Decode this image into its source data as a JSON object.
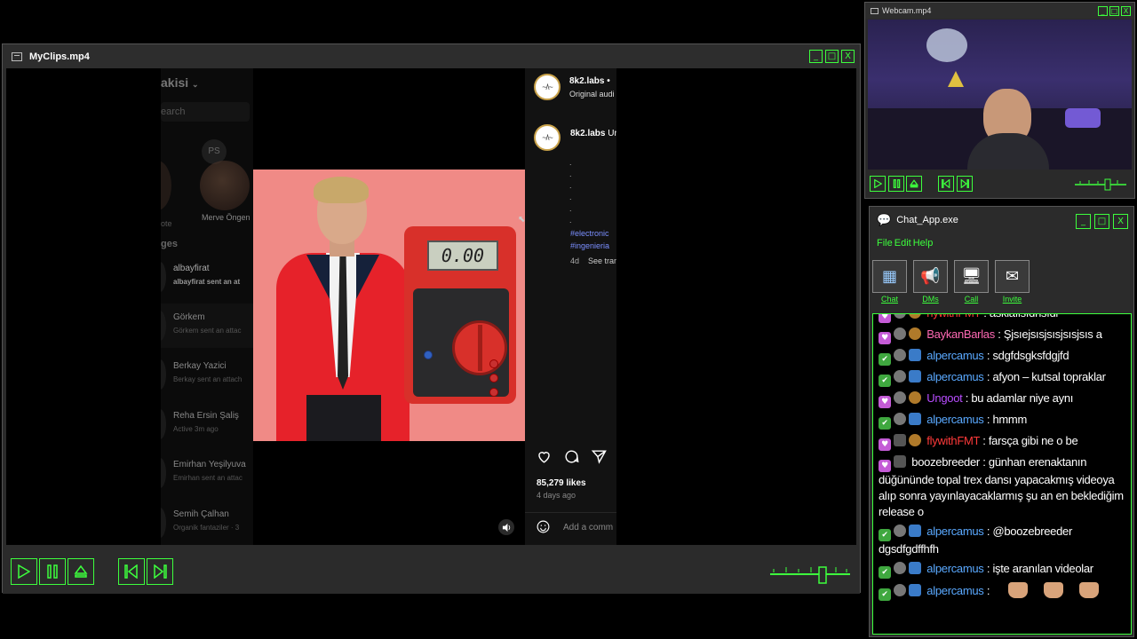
{
  "player": {
    "title": "MyClips.mp4",
    "window_buttons": [
      "_",
      "□",
      "X"
    ],
    "instagram": {
      "sidebar": {
        "account_partial": "akisi",
        "search_placeholder": "earch",
        "note_initials": "PS",
        "left_partial_label": "ote",
        "note_name": "Merve Öngen",
        "messages_heading_partial": "ges",
        "conversations": [
          {
            "name": "albayfirat",
            "sub": "albayfirat sent an at",
            "bold": true
          },
          {
            "name": "Görkem",
            "sub": "Görkem sent an attac",
            "bold": false
          },
          {
            "name": "Berkay Yazici",
            "sub": "Berkay sent an attach",
            "bold": false
          },
          {
            "name": "Reha Ersin Şaliş",
            "sub": "Active 3m ago",
            "bold": false
          },
          {
            "name": "Emirhan Yeşilyuva",
            "sub": "Emirhan sent an attac",
            "bold": false
          },
          {
            "name": "Semih Çalhan",
            "sub": "Organik fantaziler · 3",
            "bold": false
          }
        ]
      },
      "reel": {
        "lcd_reading": "0.00"
      },
      "post": {
        "author": "8k2.labs",
        "author_dot": "•",
        "audio": "Original audi",
        "caption_author": "8k2.labs",
        "caption_partial": "Ur",
        "dots": [
          ".",
          ".",
          ".",
          ".",
          ".",
          "."
        ],
        "hashtags": [
          "#electronic",
          "#ingenieria"
        ],
        "age_short": "4d",
        "see_translation": "See tran",
        "likes": "85,279 likes",
        "posted": "4 days ago",
        "add_comment": "Add a comm"
      }
    }
  },
  "webcam": {
    "title": "Webcam.mp4",
    "window_buttons": [
      "_",
      "□",
      "X"
    ]
  },
  "chat": {
    "title": "Chat_App.exe",
    "window_buttons": [
      "_",
      "□",
      "X"
    ],
    "menu": [
      "File",
      "Edit",
      "Help"
    ],
    "tools": [
      {
        "label": "Chat",
        "icon": "chat-window-icon",
        "glyph": "▦"
      },
      {
        "label": "DMs",
        "icon": "megaphone-icon",
        "glyph": "📢"
      },
      {
        "label": "Call",
        "icon": "monitor-icon",
        "glyph": "🖥"
      },
      {
        "label": "Invite",
        "icon": "envelope-icon",
        "glyph": "✉"
      }
    ],
    "messages": [
      {
        "user": "nywithFMT",
        "color": "#ff3a3a",
        "text": "asklafisfdnsfdl",
        "badges": [
          "heart",
          "grey",
          "av2"
        ]
      },
      {
        "user": "BaykanBarlas",
        "color": "#ff69b4",
        "text": "Şjsıejsısjsısjsısjsıs a",
        "badges": [
          "heart",
          "grey",
          "av2"
        ]
      },
      {
        "user": "alpercamus",
        "color": "#5aa9ff",
        "text": "sdgfdsgksfdgjfd",
        "badges": [
          "check",
          "grey",
          "av"
        ]
      },
      {
        "user": "alpercamus",
        "color": "#5aa9ff",
        "text": "afyon – kutsal topraklar",
        "badges": [
          "check",
          "grey",
          "av"
        ]
      },
      {
        "user": "Ungoot",
        "color": "#b84dff",
        "text": "bu adamlar niye aynı",
        "badges": [
          "heart",
          "grey",
          "av2"
        ]
      },
      {
        "user": "alpercamus",
        "color": "#5aa9ff",
        "text": "hmmm",
        "badges": [
          "check",
          "grey",
          "av"
        ]
      },
      {
        "user": "flywithFMT",
        "color": "#ff3a3a",
        "text": "farsça gibi ne o be",
        "badges": [
          "heart",
          "av3",
          "av2"
        ]
      },
      {
        "user": "boozebreeder",
        "color": "#ffffff",
        "text": "günhan erenaktanın düğününde topal trex dansı yapacakmış videoya alıp sonra yayınlayacaklarmış şu an en beklediğim release o",
        "badges": [
          "heart",
          "av3"
        ]
      },
      {
        "user": "alpercamus",
        "color": "#5aa9ff",
        "text": "@boozebreeder dgsdfgdffhfh",
        "badges": [
          "check",
          "grey",
          "av"
        ]
      },
      {
        "user": "alpercamus",
        "color": "#5aa9ff",
        "text": "işte aranılan videolar",
        "badges": [
          "check",
          "grey",
          "av"
        ]
      },
      {
        "user": "alpercamus",
        "color": "#5aa9ff",
        "text": "",
        "badges": [
          "check",
          "grey",
          "av"
        ],
        "emotes": 3
      }
    ]
  },
  "colors": {
    "accent": "#3dff3d",
    "window_bg": "#2b2b2b",
    "instagram_link": "#7b8fff"
  }
}
